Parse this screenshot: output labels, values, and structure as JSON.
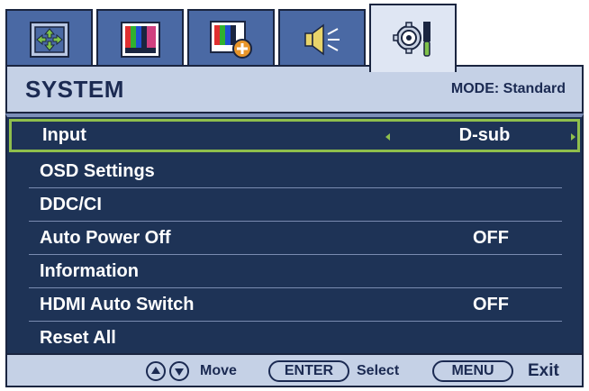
{
  "tabs": [
    {
      "icon": "picture-position-icon",
      "active": false
    },
    {
      "icon": "picture-color-bars-icon",
      "active": false
    },
    {
      "icon": "picture-advanced-icon",
      "active": false
    },
    {
      "icon": "audio-speaker-icon",
      "active": false
    },
    {
      "icon": "system-settings-gear-icon",
      "active": true
    }
  ],
  "header": {
    "title": "SYSTEM",
    "mode": "MODE: Standard"
  },
  "menu": {
    "items": [
      {
        "label": "Input",
        "value": "D-sub",
        "selected": true
      },
      {
        "label": "OSD Settings",
        "value": ""
      },
      {
        "label": "DDC/CI",
        "value": ""
      },
      {
        "label": "Auto Power Off",
        "value": "OFF"
      },
      {
        "label": "Information",
        "value": ""
      },
      {
        "label": "HDMI Auto Switch",
        "value": "OFF"
      },
      {
        "label": "Reset All",
        "value": ""
      }
    ]
  },
  "footer": {
    "move_label": "Move",
    "enter_key": "ENTER",
    "select_label": "Select",
    "menu_key": "MENU",
    "exit_label": "Exit"
  },
  "colors": {
    "menu_bg": "#1e3356",
    "header_bg": "#c5d1e6",
    "tab_bg": "#4a69a4",
    "selection": "#8fbf4c",
    "text_dark": "#1b2a52"
  }
}
